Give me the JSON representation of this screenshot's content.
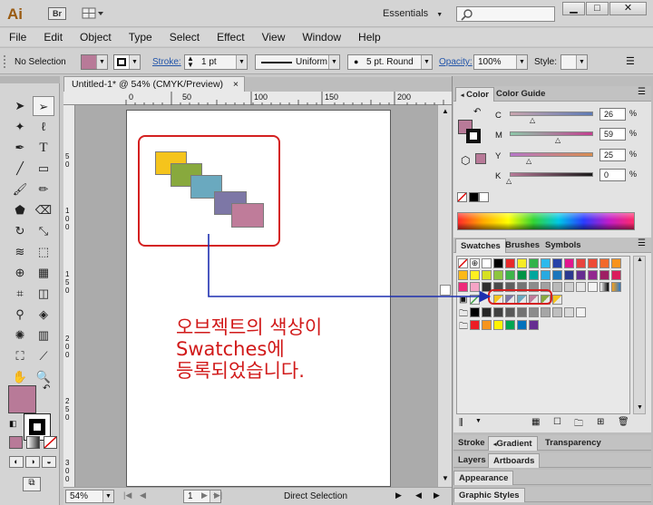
{
  "app": {
    "logo": "Ai",
    "bridge_badge": "Br",
    "workspace": "Essentials",
    "search_placeholder": "",
    "window_buttons": [
      "minimize",
      "restore",
      "close"
    ]
  },
  "menu": [
    "File",
    "Edit",
    "Object",
    "Type",
    "Select",
    "Effect",
    "View",
    "Window",
    "Help"
  ],
  "control": {
    "selection": "No Selection",
    "fill_color": "#b87a98",
    "stroke_label": "Stroke:",
    "stroke_weight": "1 pt",
    "stroke_profile": "Uniform",
    "brush": "5 pt. Round",
    "opacity_label": "Opacity:",
    "opacity": "100%",
    "style_label": "Style:"
  },
  "document": {
    "tab_title": "Untitled-1* @ 54% (CMYK/Preview)",
    "ruler_top": [
      "0",
      "50",
      "100",
      "150",
      "200"
    ],
    "ruler_left": [
      "5",
      "0",
      "1",
      "0",
      "0",
      "1",
      "5",
      "0",
      "2",
      "0",
      "0",
      "2",
      "5",
      "0",
      "3",
      "0",
      "0"
    ],
    "artwork_colors": [
      "#f5c41c",
      "#88a93d",
      "#6aa9bf",
      "#7d77a6",
      "#bf7c9a"
    ],
    "annotation_lines": [
      "오브젝트의 색상이",
      "Swatches에",
      "등록되었습니다."
    ]
  },
  "status": {
    "zoom": "54%",
    "artboard": "1",
    "tool": "Direct Selection"
  },
  "color_panel": {
    "tabs": [
      "Color",
      "Color Guide"
    ],
    "channels": [
      {
        "label": "C",
        "value": "26"
      },
      {
        "label": "M",
        "value": "59"
      },
      {
        "label": "Y",
        "value": "25"
      },
      {
        "label": "K",
        "value": "0"
      }
    ]
  },
  "swatches_panel": {
    "tabs": [
      "Swatches",
      "Brushes",
      "Symbols"
    ]
  },
  "collapsed_panels": {
    "group1": [
      "Stroke",
      "Gradient",
      "Transparency"
    ],
    "group2": [
      "Layers",
      "Artboards"
    ],
    "group3": [
      "Appearance"
    ],
    "group4": [
      "Graphic Styles"
    ]
  },
  "colors": {
    "accent_red": "#d42020",
    "arrow_blue": "#1d2fb0",
    "fill": "#b87a98"
  }
}
